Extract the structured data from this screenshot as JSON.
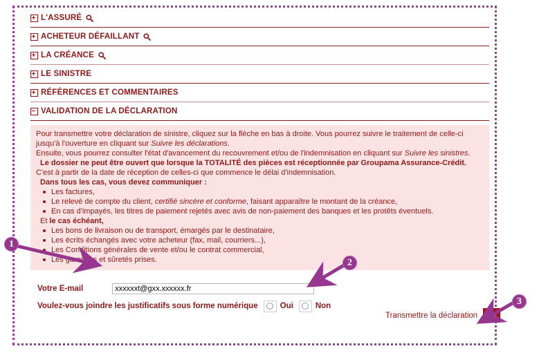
{
  "sections": [
    {
      "label": "L'ASSURÉ",
      "state": "collapsed",
      "has_search": true
    },
    {
      "label": "ACHETEUR DÉFAILLANT",
      "state": "collapsed",
      "has_search": true
    },
    {
      "label": "LA CRÉANCE",
      "state": "collapsed",
      "has_search": true
    },
    {
      "label": "LE SINISTRE",
      "state": "collapsed",
      "has_search": false
    },
    {
      "label": "RÉFÉRENCES ET COMMENTAIRES",
      "state": "collapsed",
      "has_search": false
    },
    {
      "label": "VALIDATION DE LA DÉCLARATION",
      "state": "expanded",
      "has_search": false
    }
  ],
  "panel": {
    "para1_a": "Pour transmettre votre déclaration de sinistre, cliquez sur la flèche en bas à droite. Vous pourrez suivre le traitement de celle-ci jusqu'à l'ouverture en cliquant sur ",
    "para1_link": "Suivre les déclarations",
    "para1_end": ".",
    "para2_a": "Ensuite, vous pourrez consulter l'état d'avancement du recouvrement et/ou de l'indemnisation en cliquant sur ",
    "para2_link": "Suivre les sinistres",
    "para2_end": ".",
    "para3_bold": "Le dossier ne peut être ouvert que lorsque la TOTALITÉ des pièces est réceptionnée par Groupama Assurance-Crédit.",
    "para4": "C'est à partir de la date de réception de celles-ci que commence le délai d'indemnisation.",
    "heading1": "Dans tous les cas, vous devez communiquer :",
    "list1": [
      "Les factures,",
      "Le relevé de compte du client, certifié sincère et conforme, faisant apparaître le montant de la créance,",
      "En cas d'impayés, les titres de paiement rejetés avec avis de non-paiement des banques et les protêts éventuels."
    ],
    "list1_italic_a": "Le relevé de compte du client, ",
    "list1_italic_b": "certifié sincère et conforme",
    "list1_italic_c": ", faisant apparaître le montant de la créance,",
    "heading2": "Et le cas échéant,",
    "list2": [
      "Les bons de livraison ou de transport, émargés par le destinataire,",
      "Les écrits échangés avec votre acheteur (fax, mail, courriers...),",
      "Les Conditions générales de vente et/ou le contrat commercial,",
      "Les garanties et sûretés prises."
    ]
  },
  "form": {
    "email_label": "Votre E-mail",
    "email_value": "xxxxxxt@gxx.xxxxxx.fr",
    "question_label": "Voulez-vous joindre les justificatifs sous forme numérique",
    "option_yes": "Oui",
    "option_no": "Non",
    "yes_checked": false,
    "no_checked": false
  },
  "submit": {
    "label": "Transmettre la déclaration",
    "icon": "arrow-right-icon"
  },
  "annotations": [
    {
      "number": "1",
      "target": "email-field"
    },
    {
      "number": "2",
      "target": "radio-group"
    },
    {
      "number": "3",
      "target": "submit-button"
    }
  ],
  "colors": {
    "accent_dark_red": "#8c1a1a",
    "panel_pink": "#fbe3e3",
    "annotation_purple": "#96368f",
    "submit_red": "#a31515",
    "frame_purple": "#9b3ba0"
  }
}
